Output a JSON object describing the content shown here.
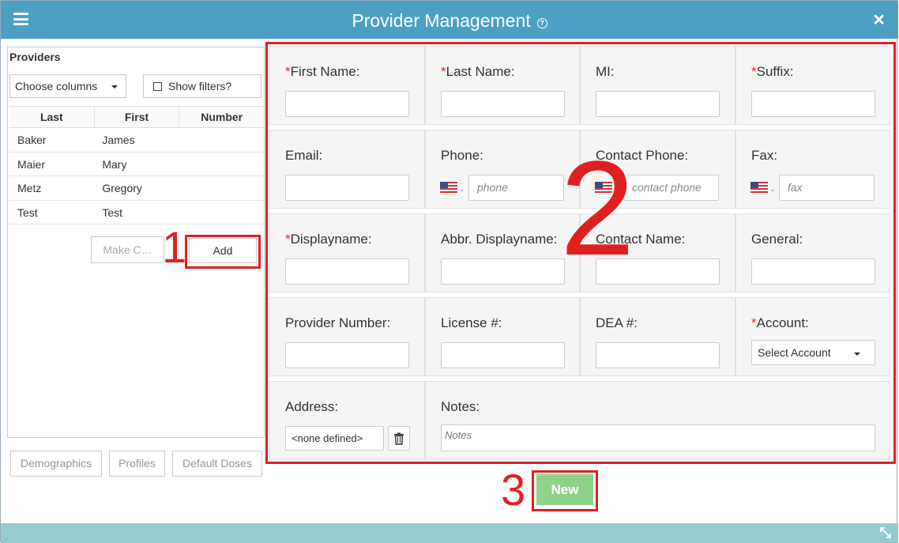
{
  "window": {
    "title": "Provider Management"
  },
  "colors": {
    "titlebar": "#4d9fc3",
    "accent_new": "#8fd38b",
    "annotation": "#e02020",
    "required": "#d9302c",
    "footer": "#94cbd0"
  },
  "providers": {
    "title": "Providers",
    "choose_columns": "Choose columns",
    "show_filters": "Show filters?",
    "columns": [
      "Last",
      "First",
      "Number"
    ],
    "rows": [
      {
        "last": "Baker",
        "first": "James",
        "number": ""
      },
      {
        "last": "Maier",
        "first": "Mary",
        "number": ""
      },
      {
        "last": "Metz",
        "first": "Gregory",
        "number": ""
      },
      {
        "last": "Test",
        "first": "Test",
        "number": ""
      }
    ],
    "make_label": "Make C…",
    "add_label": "Add"
  },
  "bottom_buttons": {
    "demographics": "Demographics",
    "profiles": "Profiles",
    "default_doses": "Default Doses"
  },
  "form": {
    "first_name": "First Name:",
    "last_name": "Last Name:",
    "mi": "MI:",
    "suffix": "Suffix:",
    "email": "Email:",
    "phone": "Phone:",
    "phone_placeholder": "phone",
    "contact_phone": "Contact Phone:",
    "contact_phone_placeholder": "contact phone",
    "fax": "Fax:",
    "fax_placeholder": "fax",
    "displayname": "Displayname:",
    "abbr_displayname": "Abbr. Displayname:",
    "contact_name": "Contact Name:",
    "general": "General:",
    "provider_number": "Provider Number:",
    "license": "License #:",
    "dea": "DEA #:",
    "account": "Account:",
    "account_select": "Select Account",
    "address": "Address:",
    "address_value": "<none defined>",
    "notes": "Notes:",
    "notes_placeholder": "Notes",
    "required_mark": "*"
  },
  "new_button": "New",
  "annotations": {
    "one": "1",
    "two": "2",
    "three": "3"
  },
  "icons": {
    "menu": "menu-icon",
    "help": "help-icon",
    "close": "close-icon",
    "trash": "trash-icon",
    "flag": "us-flag-icon",
    "resize": "resize-icon"
  }
}
